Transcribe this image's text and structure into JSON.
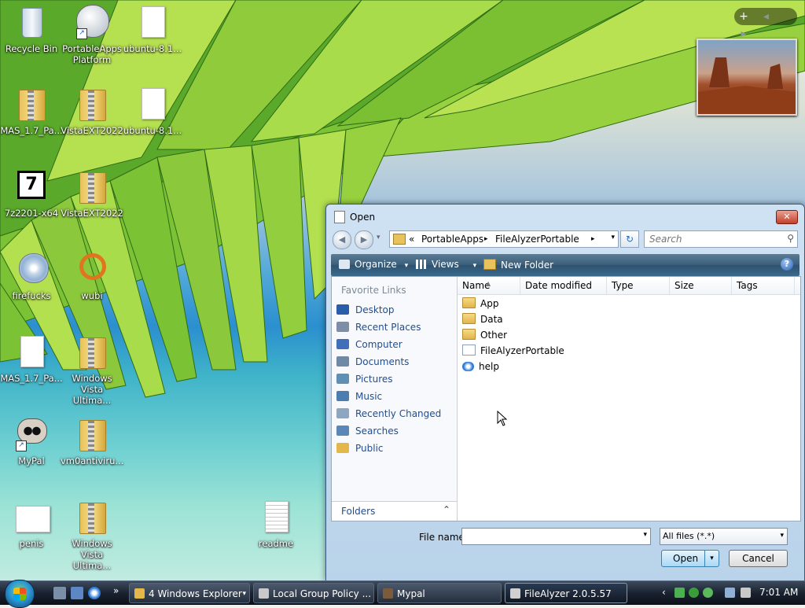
{
  "desktop": {
    "icons": [
      {
        "label": "Recycle Bin"
      },
      {
        "label": "PortableApps Platform"
      },
      {
        "label": "ubuntu-8.1..."
      },
      {
        "label": "MAS_1.7_Pa..."
      },
      {
        "label": "VistaEXT2022"
      },
      {
        "label": "ubuntu-8.1..."
      },
      {
        "label": "7z2201-x64"
      },
      {
        "label": "VistaEXT2022"
      },
      {
        "label": "firefucks"
      },
      {
        "label": "wubi"
      },
      {
        "label": "MAS_1.7_Pa..."
      },
      {
        "label": "Windows Vista Ultima..."
      },
      {
        "label": "MyPal"
      },
      {
        "label": "vm0antiviru..."
      },
      {
        "label": "penis"
      },
      {
        "label": "Windows Vista Ultima..."
      },
      {
        "label": "readme"
      }
    ]
  },
  "sidebar_gadgets": {
    "add_glyph": "+",
    "prev_glyph": "◂",
    "next_glyph": "▸"
  },
  "dialog": {
    "title": "Open",
    "close_glyph": "✕",
    "nav": {
      "back_glyph": "◀",
      "forward_glyph": "▶",
      "recent_glyph": "▾",
      "breadcrumb_overflow": "«",
      "breadcrumb": [
        "PortableApps",
        "FileAlyzerPortable"
      ],
      "separator": "▸",
      "dropdown_glyph": "▾",
      "refresh_glyph": "↻",
      "search_placeholder": "Search",
      "search_glyph": "⚲"
    },
    "toolbar": {
      "organize": "Organize",
      "views": "Views",
      "new_folder": "New Folder",
      "drop_glyph": "▾",
      "help_glyph": "?"
    },
    "favorites": {
      "heading": "Favorite Links",
      "items": [
        {
          "label": "Desktop",
          "color": "#2a5caa"
        },
        {
          "label": "Recent Places",
          "color": "#7d8fa6"
        },
        {
          "label": "Computer",
          "color": "#3e6fb8"
        },
        {
          "label": "Documents",
          "color": "#6f8aa6"
        },
        {
          "label": "Pictures",
          "color": "#5f8fb5"
        },
        {
          "label": "Music",
          "color": "#4c7fb0"
        },
        {
          "label": "Recently Changed",
          "color": "#8fa6c0"
        },
        {
          "label": "Searches",
          "color": "#5a87b8"
        },
        {
          "label": "Public",
          "color": "#e3b74a"
        }
      ],
      "folders_label": "Folders",
      "folders_toggle": "⌃"
    },
    "columns": [
      "Name",
      "Date modified",
      "Type",
      "Size",
      "Tags"
    ],
    "sort_glyph": "▲",
    "files": [
      {
        "name": "App",
        "kind": "folder"
      },
      {
        "name": "Data",
        "kind": "folder"
      },
      {
        "name": "Other",
        "kind": "folder"
      },
      {
        "name": "FileAlyzerPortable",
        "kind": "app"
      },
      {
        "name": "help",
        "kind": "web"
      }
    ],
    "filename_label": "File name:",
    "filename_value": "",
    "filter_value": "All files (*.*)",
    "open_label": "Open",
    "cancel_label": "Cancel"
  },
  "taskbar": {
    "overflow_glyph": "»",
    "buttons": [
      {
        "label": "4 Windows Explorer",
        "color": "#e3b74a"
      },
      {
        "label": "Local Group Policy ...",
        "color": "#c9c9c9"
      },
      {
        "label": "Mypal",
        "color": "#7a5b3c"
      },
      {
        "label": "FileAlyzer 2.0.5.57",
        "color": "#d0d0d0"
      }
    ],
    "tray_arrow": "‹",
    "clock": "7:01 AM"
  },
  "colors": {
    "accent": "#2e5371",
    "link": "#1e4d96",
    "folder": "#e3b74a"
  }
}
